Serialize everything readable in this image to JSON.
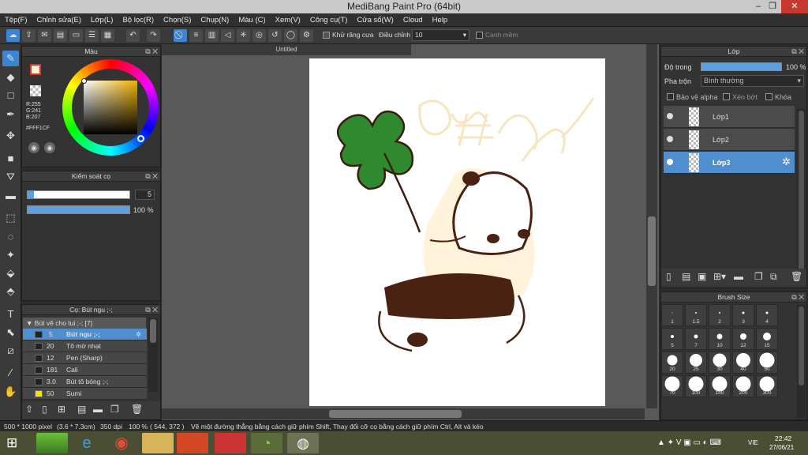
{
  "window": {
    "title": "MediBang Paint Pro (64bit)"
  },
  "menu": [
    "Tệp(F)",
    "Chỉnh sửa(E)",
    "Lớp(L)",
    "Bộ lọc(R)",
    "Chọn(S)",
    "Chụp(N)",
    "Màu (C)",
    "Xem(V)",
    "Công cụ(T)",
    "Cửa sổ(W)",
    "Cloud",
    "Help"
  ],
  "toolbar": {
    "antialias_label": "Khử răng cưa",
    "adjust_label": "Điều chỉnh",
    "adjust_value": "10",
    "edge_label": "Canh mềm"
  },
  "color_panel": {
    "title": "Màu",
    "r": "R:255",
    "g": "G:241",
    "b": "B:207",
    "hex": "#FFF1CF",
    "swatch": "#FFF1CF"
  },
  "brush_control": {
    "title": "Kiểm soát cọ",
    "size_value": "5",
    "opacity_value": "100 %",
    "opacity_fraction": 1.0
  },
  "brush_panel": {
    "title": "Cọ: Bút ngu ;-;",
    "group": "Bút vẽ cho tui ;-; [7]",
    "items": [
      {
        "size": "5",
        "name": "Bút ngu ;-;"
      },
      {
        "size": "20",
        "name": "Tô mờ nhạt"
      },
      {
        "size": "12",
        "name": "Pen (Sharp)"
      },
      {
        "size": "181",
        "name": "Cali"
      },
      {
        "size": "3.0",
        "name": "Bút tô bóng ;-;"
      },
      {
        "size": "50",
        "name": "Sumi"
      }
    ]
  },
  "canvas": {
    "tab": "Untitled"
  },
  "layer_panel": {
    "title": "Lớp",
    "opacity_label": "Độ trong",
    "opacity_value": "100 %",
    "blend_label": "Pha trộn",
    "blend_value": "Bình thường",
    "protect_alpha": "Bảo vệ alpha",
    "clip": "Xén bớt",
    "lock": "Khóa",
    "layers": [
      "Lớp1",
      "Lớp2",
      "Lớp3"
    ]
  },
  "brush_size_panel": {
    "title": "Brush Size",
    "sizes": [
      "1",
      "1.5",
      "2",
      "3",
      "4",
      "5",
      "7",
      "10",
      "12",
      "15",
      "20",
      "25",
      "30",
      "40",
      "50",
      "70",
      "100",
      "150",
      "200",
      "300"
    ]
  },
  "status": {
    "dimensions": "500 * 1000 pixel",
    "physical": "(3.6 * 7.3cm)",
    "dpi": "350 dpi",
    "zoom": "100 %",
    "coords": "( 544, 372 )",
    "hint": "Vẽ một đường thẳng bằng cách giữ phím Shift, Thay đổi cỡ cọ bằng cách giữ phím Ctrl, Alt và kéo"
  },
  "taskbar": {
    "lang": "VIE",
    "time": "22:42",
    "date": "27/06/21"
  }
}
